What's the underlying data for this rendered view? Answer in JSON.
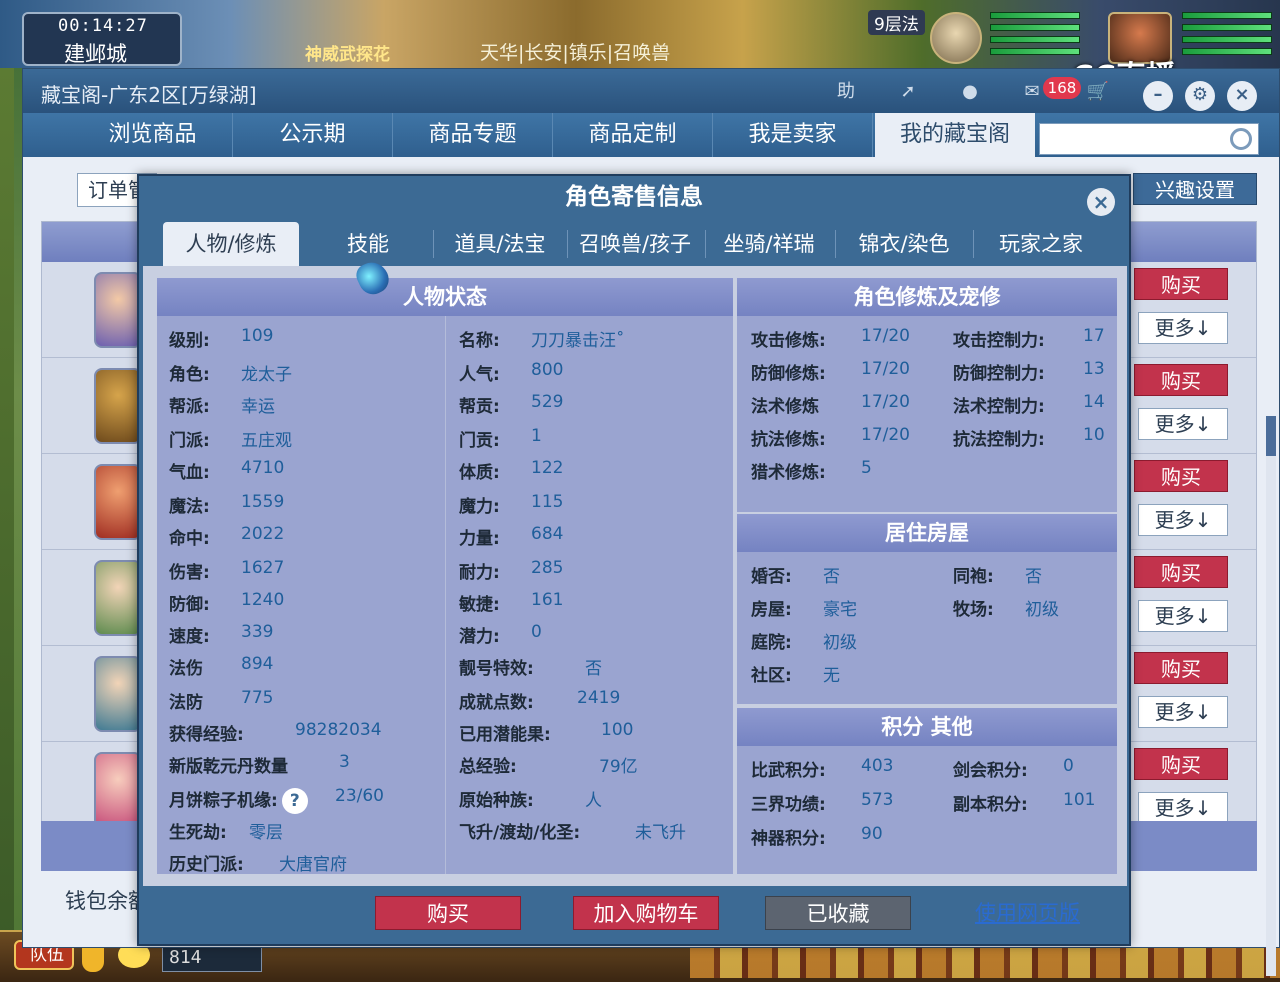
{
  "game": {
    "time": "00:14:27",
    "city": "建邺城",
    "banner": "神威武探花",
    "marquee": "天华|长安|镇乐|召唤兽",
    "top_label": "9层法",
    "cc_logo": "CC直播",
    "team_button": "队伍",
    "channel_value": "814"
  },
  "window": {
    "title": "藏宝阁-广东2区[万绿湖]",
    "help_label": "助",
    "cart_count": "168",
    "nav": [
      "浏览商品",
      "公示期",
      "商品专题",
      "商品定制",
      "我是卖家",
      "我的藏宝阁"
    ],
    "order_label": "订单管",
    "interest_label": "兴趣设置",
    "wallet_label": "钱包余额",
    "row_buy_label": "购买",
    "row_more_label": "更多↓"
  },
  "modal": {
    "title": "角色寄售信息",
    "close_label": "×",
    "tabs": [
      "人物/修炼",
      "技能",
      "道具/法宝",
      "召唤兽/孩子",
      "坐骑/祥瑞",
      "锦衣/染色",
      "玩家之家"
    ],
    "status_title": "人物状态",
    "status_left": [
      {
        "k": "级别:",
        "v": "109"
      },
      {
        "k": "角色:",
        "v": "龙太子"
      },
      {
        "k": "帮派:",
        "v": "幸运"
      },
      {
        "k": "门派:",
        "v": "五庄观"
      },
      {
        "k": "气血:",
        "v": "4710"
      },
      {
        "k": "魔法:",
        "v": "1559"
      },
      {
        "k": "命中:",
        "v": "2022"
      },
      {
        "k": "伤害:",
        "v": "1627"
      },
      {
        "k": "防御:",
        "v": "1240"
      },
      {
        "k": "速度:",
        "v": "339"
      },
      {
        "k": "法伤",
        "v": "894"
      },
      {
        "k": "法防",
        "v": "775"
      },
      {
        "k": "获得经验:",
        "v": "98282034"
      },
      {
        "k": "新版乾元丹数量",
        "v": "3"
      },
      {
        "k": "月饼粽子机缘:",
        "v": "23/60"
      },
      {
        "k": "生死劫:",
        "v": "零层"
      },
      {
        "k": "历史门派:",
        "v": "大唐官府"
      }
    ],
    "status_mid": [
      {
        "k": "名称:",
        "v": "刀刀暴击汪˚"
      },
      {
        "k": "人气:",
        "v": "800"
      },
      {
        "k": "帮贡:",
        "v": "529"
      },
      {
        "k": "门贡:",
        "v": "1"
      },
      {
        "k": "体质:",
        "v": "122"
      },
      {
        "k": "魔力:",
        "v": "115"
      },
      {
        "k": "力量:",
        "v": "684"
      },
      {
        "k": "耐力:",
        "v": "285"
      },
      {
        "k": "敏捷:",
        "v": "161"
      },
      {
        "k": "潜力:",
        "v": "0"
      },
      {
        "k": "靓号特效:",
        "v": "否"
      },
      {
        "k": "成就点数:",
        "v": "2419"
      },
      {
        "k": "已用潜能果:",
        "v": "100"
      },
      {
        "k": "总经验:",
        "v": "79亿"
      },
      {
        "k": "原始种族:",
        "v": "人"
      },
      {
        "k": "飞升/渡劫/化圣:",
        "v": "未飞升"
      }
    ],
    "cultivate_title": "角色修炼及宠修",
    "cultivate_left": [
      {
        "k": "攻击修炼:",
        "v": "17/20"
      },
      {
        "k": "防御修炼:",
        "v": "17/20"
      },
      {
        "k": "法术修炼",
        "v": "17/20"
      },
      {
        "k": "抗法修炼:",
        "v": "17/20"
      },
      {
        "k": "猎术修炼:",
        "v": "5"
      }
    ],
    "cultivate_right": [
      {
        "k": "攻击控制力:",
        "v": "17"
      },
      {
        "k": "防御控制力:",
        "v": "13"
      },
      {
        "k": "法术控制力:",
        "v": "14"
      },
      {
        "k": "抗法控制力:",
        "v": "10"
      }
    ],
    "house_title": "居住房屋",
    "house_left": [
      {
        "k": "婚否:",
        "v": "否"
      },
      {
        "k": "房屋:",
        "v": "豪宅"
      },
      {
        "k": "庭院:",
        "v": "初级"
      },
      {
        "k": "社区:",
        "v": "无"
      }
    ],
    "house_right": [
      {
        "k": "同袍:",
        "v": "否"
      },
      {
        "k": "牧场:",
        "v": "初级"
      }
    ],
    "score_title": "积分 其他",
    "score_left": [
      {
        "k": "比武积分:",
        "v": "403"
      },
      {
        "k": "三界功绩:",
        "v": "573"
      },
      {
        "k": "神器积分:",
        "v": "90"
      }
    ],
    "score_right": [
      {
        "k": "剑会积分:",
        "v": "0"
      },
      {
        "k": "副本积分:",
        "v": "101"
      }
    ],
    "buy_label": "购买",
    "cart_label": "加入购物车",
    "fav_label": "已收藏",
    "web_label": "使用网页版"
  }
}
